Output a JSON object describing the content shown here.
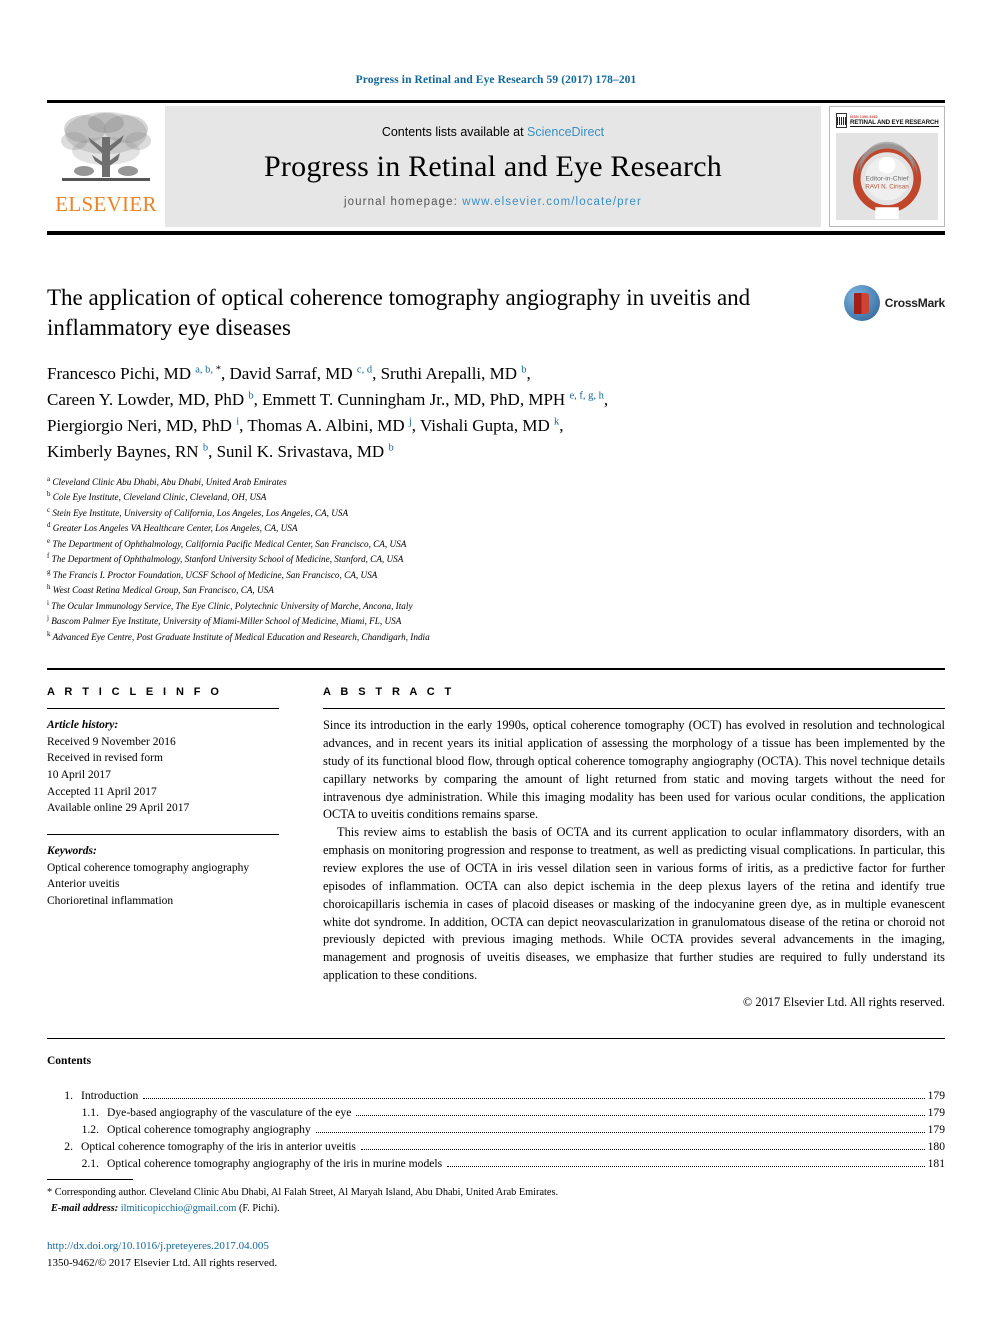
{
  "running_head": "Progress in Retinal and Eye Research 59 (2017) 178–201",
  "masthead": {
    "publisher_logo_text": "ELSEVIER",
    "contents_prefix": "Contents lists available at ",
    "contents_link": "ScienceDirect",
    "journal_title": "Progress in Retinal and Eye Research",
    "homepage_prefix": "journal homepage: ",
    "homepage_url": "www.elsevier.com/locate/prer",
    "cover": {
      "kicker": "ISSN 1350-9462",
      "title": "RETINAL AND EYE RESEARCH",
      "inner_line1": "Editor-in-Chief",
      "inner_line2": "RAVI N. Cirisan"
    }
  },
  "article": {
    "title": "The application of optical coherence tomography angiography in uveitis and inflammatory eye diseases",
    "crossmark_label": "CrossMark",
    "authors_lines": [
      "Francesco Pichi, MD a, b, *, David Sarraf, MD c, d, Sruthi Arepalli, MD b,",
      "Careen Y. Lowder, MD, PhD b, Emmett T. Cunningham Jr., MD, PhD, MPH e, f, g, h,",
      "Piergiorgio Neri, MD, PhD i, Thomas A. Albini, MD j, Vishali Gupta, MD k,",
      "Kimberly Baynes, RN b, Sunil K. Srivastava, MD b"
    ],
    "affiliations": [
      {
        "mark": "a",
        "text": "Cleveland Clinic Abu Dhabi, Abu Dhabi, United Arab Emirates"
      },
      {
        "mark": "b",
        "text": "Cole Eye Institute, Cleveland Clinic, Cleveland, OH, USA"
      },
      {
        "mark": "c",
        "text": "Stein Eye Institute, University of California, Los Angeles, Los Angeles, CA, USA"
      },
      {
        "mark": "d",
        "text": "Greater Los Angeles VA Healthcare Center, Los Angeles, CA, USA"
      },
      {
        "mark": "e",
        "text": "The Department of Ophthalmology, California Pacific Medical Center, San Francisco, CA, USA"
      },
      {
        "mark": "f",
        "text": "The Department of Ophthalmology, Stanford University School of Medicine, Stanford, CA, USA"
      },
      {
        "mark": "g",
        "text": "The Francis I. Proctor Foundation, UCSF School of Medicine, San Francisco, CA, USA"
      },
      {
        "mark": "h",
        "text": "West Coast Retina Medical Group, San Francisco, CA, USA"
      },
      {
        "mark": "i",
        "text": "The Ocular Immunology Service, The Eye Clinic, Polytechnic University of Marche, Ancona, Italy"
      },
      {
        "mark": "j",
        "text": "Bascom Palmer Eye Institute, University of Miami-Miller School of Medicine, Miami, FL, USA"
      },
      {
        "mark": "k",
        "text": "Advanced Eye Centre, Post Graduate Institute of Medical Education and Research, Chandigarh, India"
      }
    ]
  },
  "article_info": {
    "heading": "A R T I C L E   I N F O",
    "history_label": "Article history:",
    "history": [
      "Received 9 November 2016",
      "Received in revised form",
      "10 April 2017",
      "Accepted 11 April 2017",
      "Available online 29 April 2017"
    ],
    "keywords_label": "Keywords:",
    "keywords": [
      "Optical coherence tomography angiography",
      "Anterior uveitis",
      "Chorioretinal inflammation"
    ]
  },
  "abstract": {
    "heading": "A B S T R A C T",
    "paragraphs": [
      "Since its introduction in the early 1990s, optical coherence tomography (OCT) has evolved in resolution and technological advances, and in recent years its initial application of assessing the morphology of a tissue has been implemented by the study of its functional blood flow, through optical coherence tomography angiography (OCTA). This novel technique details capillary networks by comparing the amount of light returned from static and moving targets without the need for intravenous dye administration. While this imaging modality has been used for various ocular conditions, the application OCTA to uveitis conditions remains sparse.",
      "This review aims to establish the basis of OCTA and its current application to ocular inflammatory disorders, with an emphasis on monitoring progression and response to treatment, as well as predicting visual complications. In particular, this review explores the use of OCTA in iris vessel dilation seen in various forms of iritis, as a predictive factor for further episodes of inflammation. OCTA can also depict ischemia in the deep plexus layers of the retina and identify true choroicapillaris ischemia in cases of placoid diseases or masking of the indocyanine green dye, as in multiple evanescent white dot syndrome. In addition, OCTA can depict neovascularization in granulomatous disease of the retina or choroid not previously depicted with previous imaging methods. While OCTA provides several advancements in the imaging, management and prognosis of uveitis diseases, we emphasize that further studies are required to fully understand its application to these conditions."
    ],
    "copyright": "© 2017 Elsevier Ltd. All rights reserved."
  },
  "contents": {
    "heading": "Contents",
    "entries": [
      {
        "num": "1.",
        "sub": "",
        "title": "Introduction",
        "page": "179"
      },
      {
        "num": "",
        "sub": "1.1.",
        "title": "Dye-based angiography of the vasculature of the eye",
        "page": "179"
      },
      {
        "num": "",
        "sub": "1.2.",
        "title": "Optical coherence tomography angiography",
        "page": "179"
      },
      {
        "num": "2.",
        "sub": "",
        "title": "Optical coherence tomography of the iris in anterior uveitis",
        "page": "180"
      },
      {
        "num": "",
        "sub": "2.1.",
        "title": "Optical coherence tomography angiography of the iris in murine models",
        "page": "181"
      }
    ]
  },
  "footnote": {
    "corresponding_marker": "*",
    "corresponding": "Corresponding author. Cleveland Clinic Abu Dhabi, Al Falah Street, Al Maryah Island, Abu Dhabi, United Arab Emirates.",
    "email_label": "E-mail address:",
    "email": "ilmiticopicchio@gmail.com",
    "email_owner": "(F. Pichi).",
    "doi": "http://dx.doi.org/10.1016/j.preteyeres.2017.04.005",
    "issn_line": "1350-9462/© 2017 Elsevier Ltd. All rights reserved."
  },
  "colors": {
    "link_blue": "#12679b",
    "sciencedirect_blue": "#3a8fc4",
    "elsevier_orange": "#ec8324",
    "band_gray": "#e6e6e6"
  }
}
